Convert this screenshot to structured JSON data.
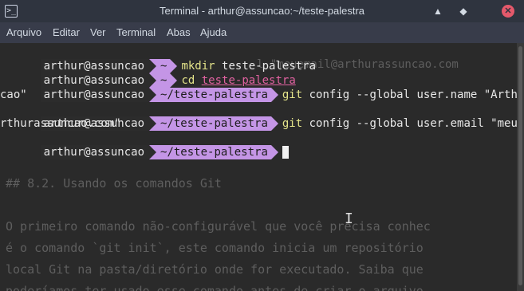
{
  "window": {
    "title": "Terminal - arthur@assuncao:~/teste-palestra",
    "app_icon": "terminal-icon",
    "controls": {
      "minimize": "▲",
      "maximize": "◆",
      "close": "✕"
    }
  },
  "menubar": {
    "items": [
      "Arquivo",
      "Editar",
      "Ver",
      "Terminal",
      "Abas",
      "Ajuda"
    ]
  },
  "terminal": {
    "prompt_user": "arthur@assuncao",
    "lines": [
      {
        "dir": "~",
        "command": "mkdir",
        "args": " teste-palestra"
      },
      {
        "dir": "~",
        "command": "cd",
        "args_underlined": "teste-palestra"
      },
      {
        "dir": "~/teste-palestra",
        "command": "git",
        "args": " config --global user.name \"ArthurAssun",
        "wrap": "cao\""
      },
      {
        "dir": "~/teste-palestra",
        "command": "git",
        "args": " config --global user.email \"meuemail@a",
        "wrap": "rthurassuncao.com\""
      },
      {
        "dir": "~/teste-palestra",
        "cursor": true
      }
    ],
    "background_text": [
      "## 8.2. Usando os comandos Git",
      "",
      "O primeiro comando não-configurável que você precisa conhec",
      "é o comando `git init`, este comando inicia um repositório",
      "local Git na pasta/diretório onde for executado. Saiba que",
      "poderíamos ter usado esse comando antes de criar o arquivo"
    ],
    "background_overlap": "l \"meuemail@arthurassuncao.com"
  }
}
